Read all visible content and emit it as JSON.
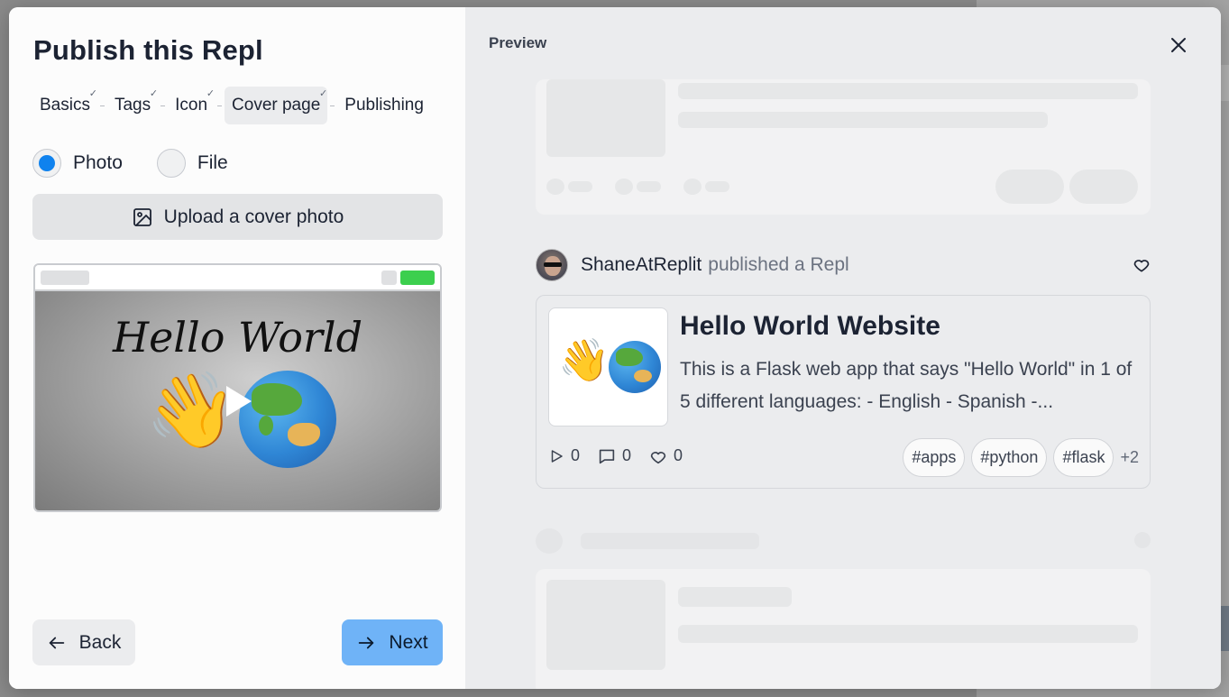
{
  "dialog": {
    "title": "Publish this Repl",
    "steps": [
      {
        "label": "Basics",
        "done": true
      },
      {
        "label": "Tags",
        "done": true
      },
      {
        "label": "Icon",
        "done": true
      },
      {
        "label": "Cover page",
        "done": true,
        "active": true
      },
      {
        "label": "Publishing",
        "done": false
      }
    ],
    "check_glyph": "✓",
    "cover_type": {
      "options": [
        {
          "label": "Photo",
          "selected": true
        },
        {
          "label": "File",
          "selected": false
        }
      ]
    },
    "upload_label": "Upload a cover photo",
    "cover_preview": {
      "heading": "Hello World",
      "wave_emoji": "👋"
    },
    "back_label": "Back",
    "next_label": "Next"
  },
  "preview": {
    "label": "Preview",
    "author": "ShaneAtReplit",
    "action_text": "published a Repl",
    "repl": {
      "thumbnail_emoji": "👋",
      "title": "Hello World Website",
      "description": "This is a Flask web app that says \"Hello World\" in 1 of 5 different languages: - English - Spanish -...",
      "runs": "0",
      "comments": "0",
      "likes": "0",
      "tags": [
        "#apps",
        "#python",
        "#flask"
      ],
      "more_tags": "+2"
    }
  },
  "colors": {
    "accent_blue": "#0f82ee",
    "next_button": "#6fb3f7",
    "run_button_green": "#3ccf4e",
    "preview_bg": "#ebecee"
  },
  "icons": {
    "upload": "image-icon",
    "back": "arrow-left-icon",
    "next": "arrow-right-icon",
    "close": "close-icon",
    "like": "heart-icon",
    "runs": "play-icon",
    "comments": "comment-icon"
  }
}
